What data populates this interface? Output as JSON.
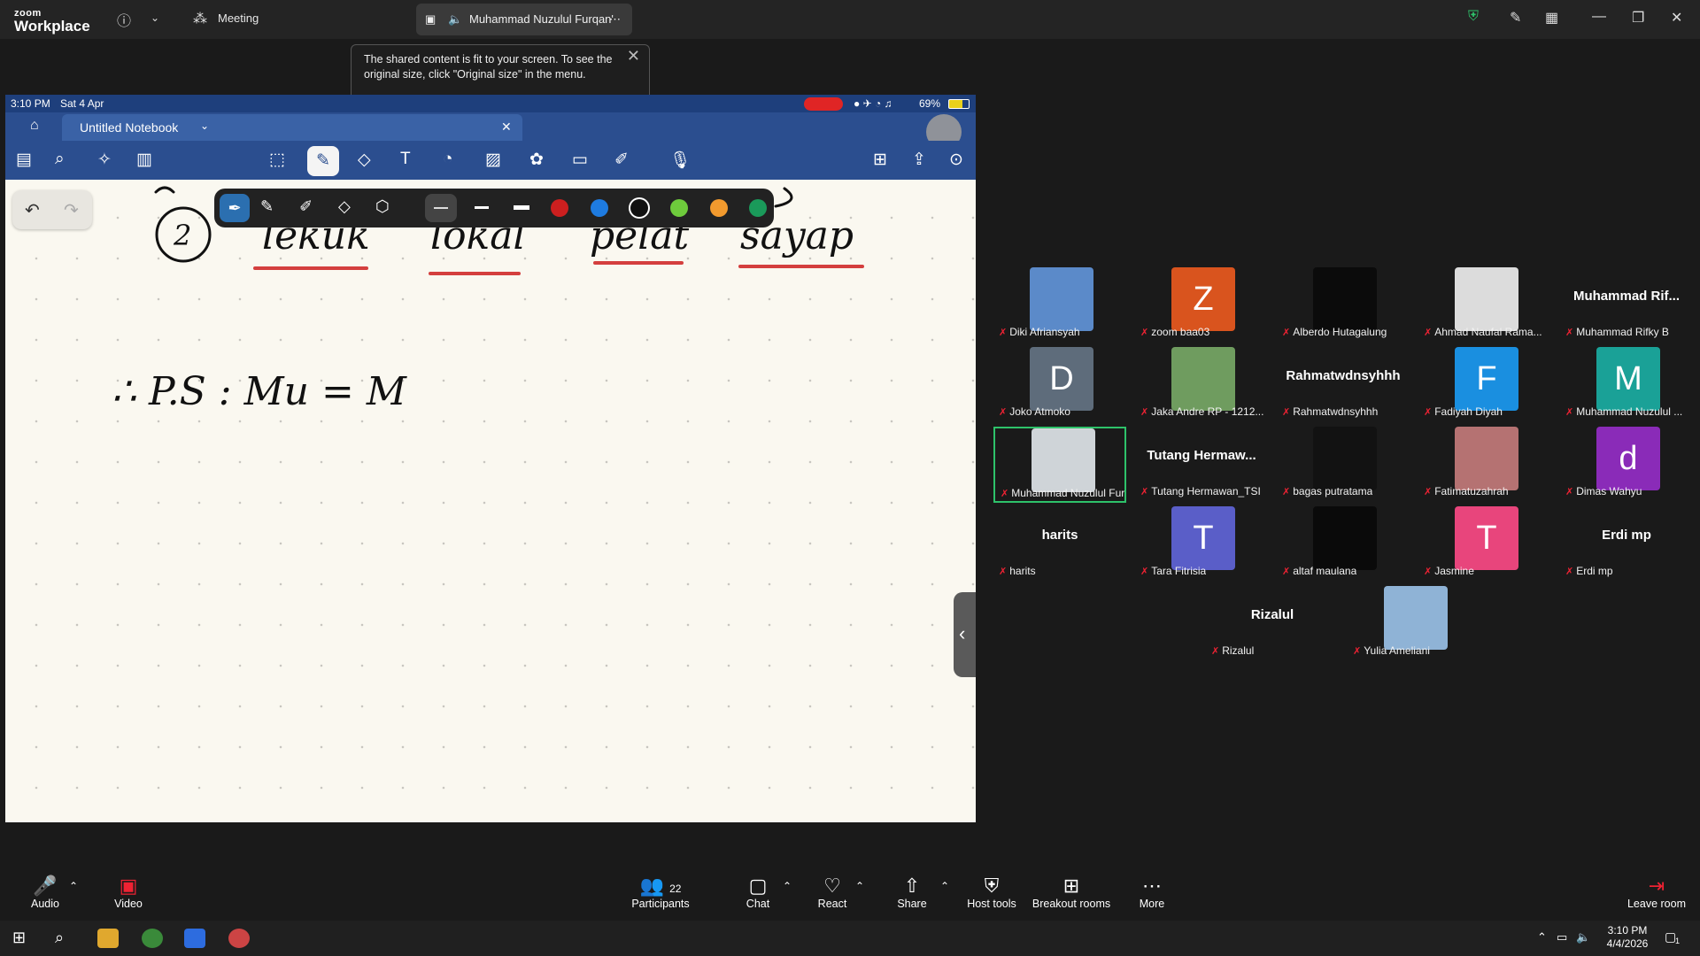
{
  "app": {
    "logo_top": "zoom",
    "logo_bottom": "Workplace",
    "meeting_label": "Meeting",
    "share_tab_title": "Muhammad Nuzulul Furqan'"
  },
  "tooltip": {
    "text": "The shared content is fit to your screen. To see the original size, click \"Original size\" in the menu."
  },
  "ipad": {
    "time": "3:10 PM",
    "date": "Sat 4 Apr",
    "battery": "69%",
    "notebook_title": "Untitled Notebook"
  },
  "handwriting": {
    "line1": "2 lekuk lokal pelat sayap",
    "line2": "∴ P.S : Mu = M"
  },
  "pen_colors": [
    "#cc1f1f",
    "#1e7be0",
    "#111111",
    "#6ecb3c",
    "#f29a2e",
    "#1a9a5a"
  ],
  "participants": [
    {
      "name": "Diki Afriansyah",
      "kind": "photo",
      "color": "#5b8ac9"
    },
    {
      "name": "zoom baa03",
      "kind": "letter",
      "letter": "Z",
      "color": "#d9541e"
    },
    {
      "name": "Alberdo Hutagalung",
      "kind": "photo",
      "color": "#0b0b0b"
    },
    {
      "name": "Ahmad Naufal Rama...",
      "kind": "photo",
      "color": "#dcdcdc"
    },
    {
      "name": "Muhammad Rifky B",
      "kind": "text",
      "big": "Muhammad  Rif..."
    },
    {
      "name": "Joko Atmoko",
      "kind": "letter",
      "letter": "D",
      "color": "#5e6c7b"
    },
    {
      "name": "Jaka Andre RP - 1212...",
      "kind": "photo",
      "color": "#6f9c5f"
    },
    {
      "name": "Rahmatwdnsyhhh",
      "kind": "text",
      "big": "Rahmatwdnsyhhh"
    },
    {
      "name": "Fadiyah Diyah",
      "kind": "letter",
      "letter": "F",
      "color": "#1a8fe0"
    },
    {
      "name": "Muhammad Nuzulul ...",
      "kind": "letter",
      "letter": "M",
      "color": "#1aa197"
    },
    {
      "name": "Muhammad Nuzulul Fur...",
      "kind": "photo",
      "color": "#cfd4d8",
      "active": true
    },
    {
      "name": "Tutang Hermawan_TSI",
      "kind": "text",
      "big": "Tutang  Hermaw..."
    },
    {
      "name": "bagas putratama",
      "kind": "photo",
      "color": "#121212"
    },
    {
      "name": "Fatimatuzahrah",
      "kind": "photo",
      "color": "#b57272"
    },
    {
      "name": "Dimas Wahyu",
      "kind": "letter",
      "letter": "d",
      "color": "#8a2bb8"
    },
    {
      "name": "harits",
      "kind": "text",
      "big": "harits"
    },
    {
      "name": "Tara Fitrisia",
      "kind": "letter",
      "letter": "T",
      "color": "#5a5ec8"
    },
    {
      "name": "altaf maulana",
      "kind": "photo",
      "color": "#0a0a0a"
    },
    {
      "name": "Jasmine",
      "kind": "letter",
      "letter": "T",
      "color": "#e8457c"
    },
    {
      "name": "Erdi mp",
      "kind": "text",
      "big": "Erdi mp"
    },
    {
      "name": "Rizalul",
      "kind": "text",
      "big": "Rizalul"
    },
    {
      "name": "Yulia Ameliani",
      "kind": "photo",
      "color": "#8fb3d6"
    }
  ],
  "bottom": {
    "audio": "Audio",
    "video": "Video",
    "participants": "Participants",
    "participants_count": "22",
    "chat": "Chat",
    "react": "React",
    "share": "Share",
    "host_tools": "Host tools",
    "breakout": "Breakout rooms",
    "more": "More",
    "leave": "Leave room"
  },
  "taskbar": {
    "time": "3:10 PM",
    "date": "4/4/2026",
    "notif_count": "1"
  }
}
